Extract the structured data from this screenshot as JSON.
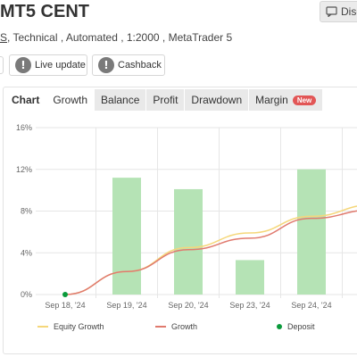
{
  "header": {
    "title": "MT5 CENT",
    "discuss_label": "Disc",
    "subtitle_first": "S",
    "subtitle_rest": ", Technical , Automated , 1:2000 , MetaTrader 5"
  },
  "badges": [
    {
      "label": "Live update",
      "icon": "info-icon"
    },
    {
      "label": "Cashback",
      "icon": "info-icon"
    }
  ],
  "tabs": [
    {
      "label": "Chart",
      "active": true
    },
    {
      "label": "Growth",
      "active": false
    },
    {
      "label": "Balance",
      "active": false
    },
    {
      "label": "Profit",
      "active": false
    },
    {
      "label": "Drawdown",
      "active": false
    },
    {
      "label": "Margin",
      "active": false,
      "badge": "New"
    }
  ],
  "colors": {
    "bar": "#b5e3b5",
    "equity_line": "#f5d77a",
    "growth_line": "#e07a6e",
    "deposit": "#0a9a3b",
    "grid": "#e6e6e6"
  },
  "chart_data": {
    "type": "bar",
    "categories": [
      "Sep 18, '24",
      "Sep 19, '24",
      "Sep 20, '24",
      "Sep 23, '24",
      "Sep 24, '24"
    ],
    "bar_values": [
      0,
      11.2,
      10.1,
      3.3,
      12.0
    ],
    "series": [
      {
        "name": "Equity Growth",
        "type": "line",
        "values": [
          0,
          2.2,
          4.5,
          5.9,
          7.5,
          8.6
        ]
      },
      {
        "name": "Growth",
        "type": "line",
        "values": [
          0,
          2.2,
          4.3,
          5.4,
          7.3,
          8.1
        ]
      }
    ],
    "line_x_positions": [
      0,
      1,
      2,
      3,
      4,
      5
    ],
    "deposit": {
      "name": "Deposit",
      "x_index": 0,
      "value": 0
    },
    "yticks": [
      "0%",
      "4%",
      "8%",
      "12%",
      "16%"
    ],
    "ylim": [
      0,
      16
    ],
    "grid": true,
    "legend_position": "bottom"
  }
}
